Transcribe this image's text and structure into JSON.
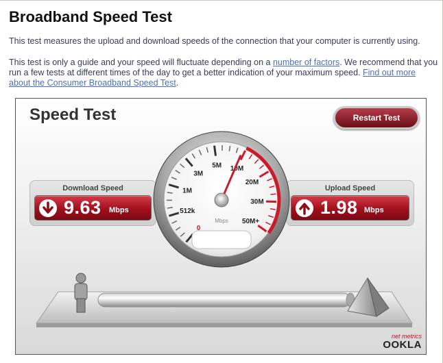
{
  "page": {
    "title": "Broadband Speed Test",
    "paragraph1": "This test measures the upload and download speeds of the connection that your computer is currently using.",
    "paragraph2": {
      "text_a": "This test is only a guide and your speed will fluctuate depending on a ",
      "link1": "number of factors",
      "text_b": ". We recommend that you run a few tests at different times of the day to get a better indication of your maximum speed. ",
      "link2": "Find out more about the Consumer Broadband Speed Test",
      "text_c": "."
    }
  },
  "widget": {
    "title": "Speed Test",
    "restart_label": "Restart Test",
    "download": {
      "label": "Download Speed",
      "value": "9.63",
      "unit": "Mbps",
      "icon": "arrow-down-icon"
    },
    "upload": {
      "label": "Upload Speed",
      "value": "1.98",
      "unit": "Mbps",
      "icon": "arrow-up-icon"
    },
    "gauge": {
      "unit": "Mbps",
      "labels": [
        "0",
        "512k",
        "1M",
        "3M",
        "5M",
        "10M",
        "20M",
        "30M",
        "50M+"
      ],
      "needle_value": "9.63",
      "accent": "#cc1a28"
    },
    "brand": {
      "tagline": "net metrics",
      "name": "OOKLA"
    }
  }
}
